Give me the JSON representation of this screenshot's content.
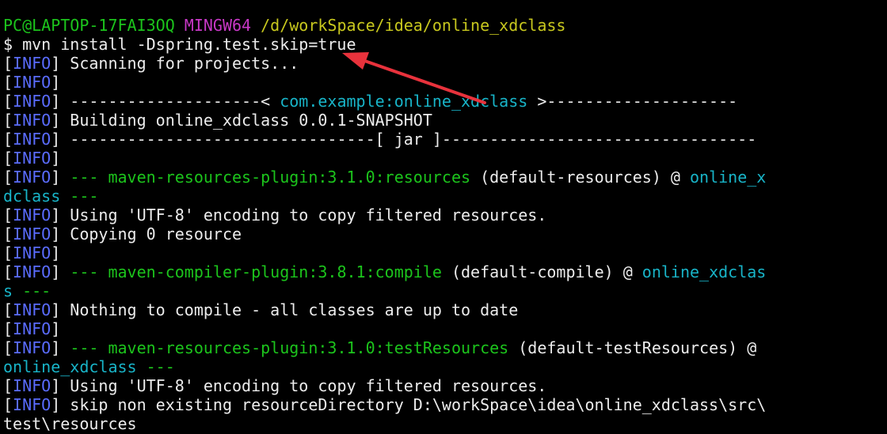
{
  "colors": {
    "background": "#000000",
    "text": "#ececec",
    "info": "#5a6cff",
    "green": "#1cc41c",
    "magenta": "#c838c6",
    "yellow": "#c8c81e",
    "cyan": "#18b4c8",
    "arrow": "#e8323c"
  },
  "terminal": {
    "lines": [
      [
        {
          "t": "PC@LAPTOP-17FAI3OQ",
          "c": "green"
        },
        {
          "t": " ",
          "c": "text"
        },
        {
          "t": "MINGW64",
          "c": "magenta"
        },
        {
          "t": " ",
          "c": "text"
        },
        {
          "t": "/d/workSpace/idea/online_xdclass",
          "c": "yellow"
        }
      ],
      [
        {
          "t": "$ mvn install -Dspring.test.skip=true",
          "c": "text"
        }
      ],
      [
        {
          "t": "[",
          "c": "text"
        },
        {
          "t": "INFO",
          "c": "info"
        },
        {
          "t": "] Scanning for projects...",
          "c": "text"
        }
      ],
      [
        {
          "t": "[",
          "c": "text"
        },
        {
          "t": "INFO",
          "c": "info"
        },
        {
          "t": "]",
          "c": "text"
        }
      ],
      [
        {
          "t": "[",
          "c": "text"
        },
        {
          "t": "INFO",
          "c": "info"
        },
        {
          "t": "] --------------------< ",
          "c": "text"
        },
        {
          "t": "com.example:online_xdclass",
          "c": "cyan"
        },
        {
          "t": " >--------------------",
          "c": "text"
        }
      ],
      [
        {
          "t": "[",
          "c": "text"
        },
        {
          "t": "INFO",
          "c": "info"
        },
        {
          "t": "] Building online_xdclass 0.0.1-SNAPSHOT",
          "c": "text"
        }
      ],
      [
        {
          "t": "[",
          "c": "text"
        },
        {
          "t": "INFO",
          "c": "info"
        },
        {
          "t": "] --------------------------------[ jar ]---------------------------------",
          "c": "text"
        }
      ],
      [
        {
          "t": "[",
          "c": "text"
        },
        {
          "t": "INFO",
          "c": "info"
        },
        {
          "t": "]",
          "c": "text"
        }
      ],
      [
        {
          "t": "[",
          "c": "text"
        },
        {
          "t": "INFO",
          "c": "info"
        },
        {
          "t": "] ",
          "c": "text"
        },
        {
          "t": "--- maven-resources-plugin:3.1.0:resources",
          "c": "green"
        },
        {
          "t": " (default-resources) @ ",
          "c": "text"
        },
        {
          "t": "online_x",
          "c": "cyan"
        }
      ],
      [
        {
          "t": "dclass",
          "c": "cyan"
        },
        {
          "t": " ",
          "c": "text"
        },
        {
          "t": "---",
          "c": "green"
        }
      ],
      [
        {
          "t": "[",
          "c": "text"
        },
        {
          "t": "INFO",
          "c": "info"
        },
        {
          "t": "] Using 'UTF-8' encoding to copy filtered resources.",
          "c": "text"
        }
      ],
      [
        {
          "t": "[",
          "c": "text"
        },
        {
          "t": "INFO",
          "c": "info"
        },
        {
          "t": "] Copying 0 resource",
          "c": "text"
        }
      ],
      [
        {
          "t": "[",
          "c": "text"
        },
        {
          "t": "INFO",
          "c": "info"
        },
        {
          "t": "]",
          "c": "text"
        }
      ],
      [
        {
          "t": "[",
          "c": "text"
        },
        {
          "t": "INFO",
          "c": "info"
        },
        {
          "t": "] ",
          "c": "text"
        },
        {
          "t": "--- maven-compiler-plugin:3.8.1:compile",
          "c": "green"
        },
        {
          "t": " (default-compile) @ ",
          "c": "text"
        },
        {
          "t": "online_xdclas",
          "c": "cyan"
        }
      ],
      [
        {
          "t": "s",
          "c": "cyan"
        },
        {
          "t": " ",
          "c": "text"
        },
        {
          "t": "---",
          "c": "green"
        }
      ],
      [
        {
          "t": "[",
          "c": "text"
        },
        {
          "t": "INFO",
          "c": "info"
        },
        {
          "t": "] Nothing to compile - all classes are up to date",
          "c": "text"
        }
      ],
      [
        {
          "t": "[",
          "c": "text"
        },
        {
          "t": "INFO",
          "c": "info"
        },
        {
          "t": "]",
          "c": "text"
        }
      ],
      [
        {
          "t": "[",
          "c": "text"
        },
        {
          "t": "INFO",
          "c": "info"
        },
        {
          "t": "] ",
          "c": "text"
        },
        {
          "t": "--- maven-resources-plugin:3.1.0:testResources",
          "c": "green"
        },
        {
          "t": " (default-testResources) @",
          "c": "text"
        }
      ],
      [
        {
          "t": "online_xdclass",
          "c": "cyan"
        },
        {
          "t": " ",
          "c": "text"
        },
        {
          "t": "---",
          "c": "green"
        }
      ],
      [
        {
          "t": "[",
          "c": "text"
        },
        {
          "t": "INFO",
          "c": "info"
        },
        {
          "t": "] Using 'UTF-8' encoding to copy filtered resources.",
          "c": "text"
        }
      ],
      [
        {
          "t": "[",
          "c": "text"
        },
        {
          "t": "INFO",
          "c": "info"
        },
        {
          "t": "] skip non existing resourceDirectory D:\\workSpace\\idea\\online_xdclass\\src\\",
          "c": "text"
        }
      ],
      [
        {
          "t": "test\\resources",
          "c": "text"
        }
      ]
    ]
  }
}
